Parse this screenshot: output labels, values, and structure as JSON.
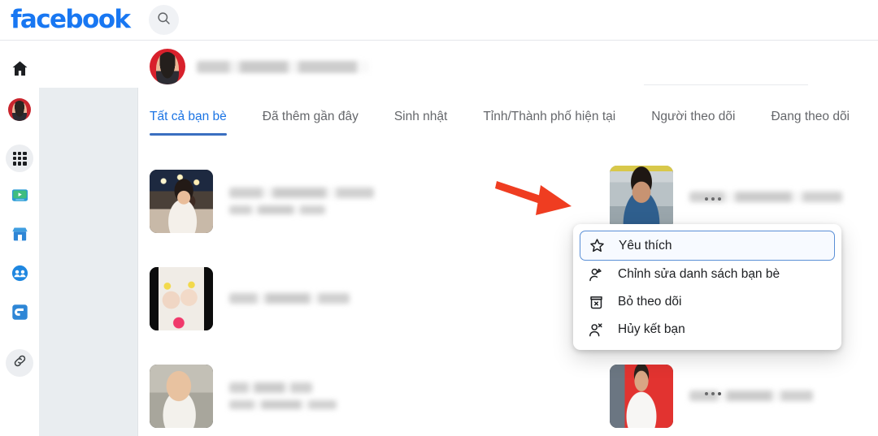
{
  "topbar": {
    "brand": "facebook",
    "brand_color": "#1877f2",
    "search_icon": "search-icon"
  },
  "left_rail": {
    "items": [
      {
        "icon": "home-icon",
        "label": "Trang chủ"
      },
      {
        "icon": "profile-avatar-icon",
        "label": "Trang cá nhân"
      },
      {
        "icon": "menu-grid-icon",
        "label": "Menu"
      },
      {
        "icon": "watch-video-icon",
        "label": "Video"
      },
      {
        "icon": "marketplace-icon",
        "label": "Marketplace"
      },
      {
        "icon": "groups-icon",
        "label": "Nhóm"
      },
      {
        "icon": "gaming-icon",
        "label": "Chơi game"
      },
      {
        "icon": "link-icon",
        "label": "Liên kết"
      }
    ]
  },
  "profile": {
    "avatar": "profile-avatar",
    "name": ""
  },
  "tabs": [
    {
      "label": "Tất cả bạn bè",
      "active": true
    },
    {
      "label": "Đã thêm gần đây",
      "active": false
    },
    {
      "label": "Sinh nhật",
      "active": false
    },
    {
      "label": "Tỉnh/Thành phố hiện tại",
      "active": false
    },
    {
      "label": "Người theo dõi",
      "active": false
    },
    {
      "label": "Đang theo dõi",
      "active": false
    }
  ],
  "tab_active_color": "#1b74e4",
  "tab_underline_color": "#3a6fc0",
  "tab_inactive_color": "#65676b",
  "friends": [
    {
      "photo": "woman-cafe-night-photo",
      "name": "",
      "subtitle": "",
      "more_label": "..."
    },
    {
      "photo": "man-blue-shirt-photo",
      "name": "",
      "subtitle": "",
      "more_label": "..."
    },
    {
      "photo": "two-babies-photo",
      "name": "",
      "subtitle": "",
      "more_label": "..."
    },
    {
      "photo": "baby-high-chair-photo",
      "name": "",
      "subtitle": "",
      "more_label": "..."
    },
    {
      "photo": "man-red-background-photo",
      "name": "",
      "subtitle": "",
      "more_label": "..."
    }
  ],
  "annotation": {
    "arrow": "red-arrow-pointing-right",
    "arrow_color": "#ef3d21"
  },
  "menu": {
    "items": [
      {
        "icon": "star-icon",
        "label": "Yêu thích",
        "selected": true
      },
      {
        "icon": "person-edit-icon",
        "label": "Chỉnh sửa danh sách bạn bè",
        "selected": false
      },
      {
        "icon": "unfollow-box-icon",
        "label": "Bỏ theo dõi",
        "selected": false
      },
      {
        "icon": "person-remove-icon",
        "label": "Hủy kết bạn",
        "selected": false
      }
    ],
    "selected_border_color": "#5a8fd6",
    "selected_bg_color": "#f7faff"
  }
}
